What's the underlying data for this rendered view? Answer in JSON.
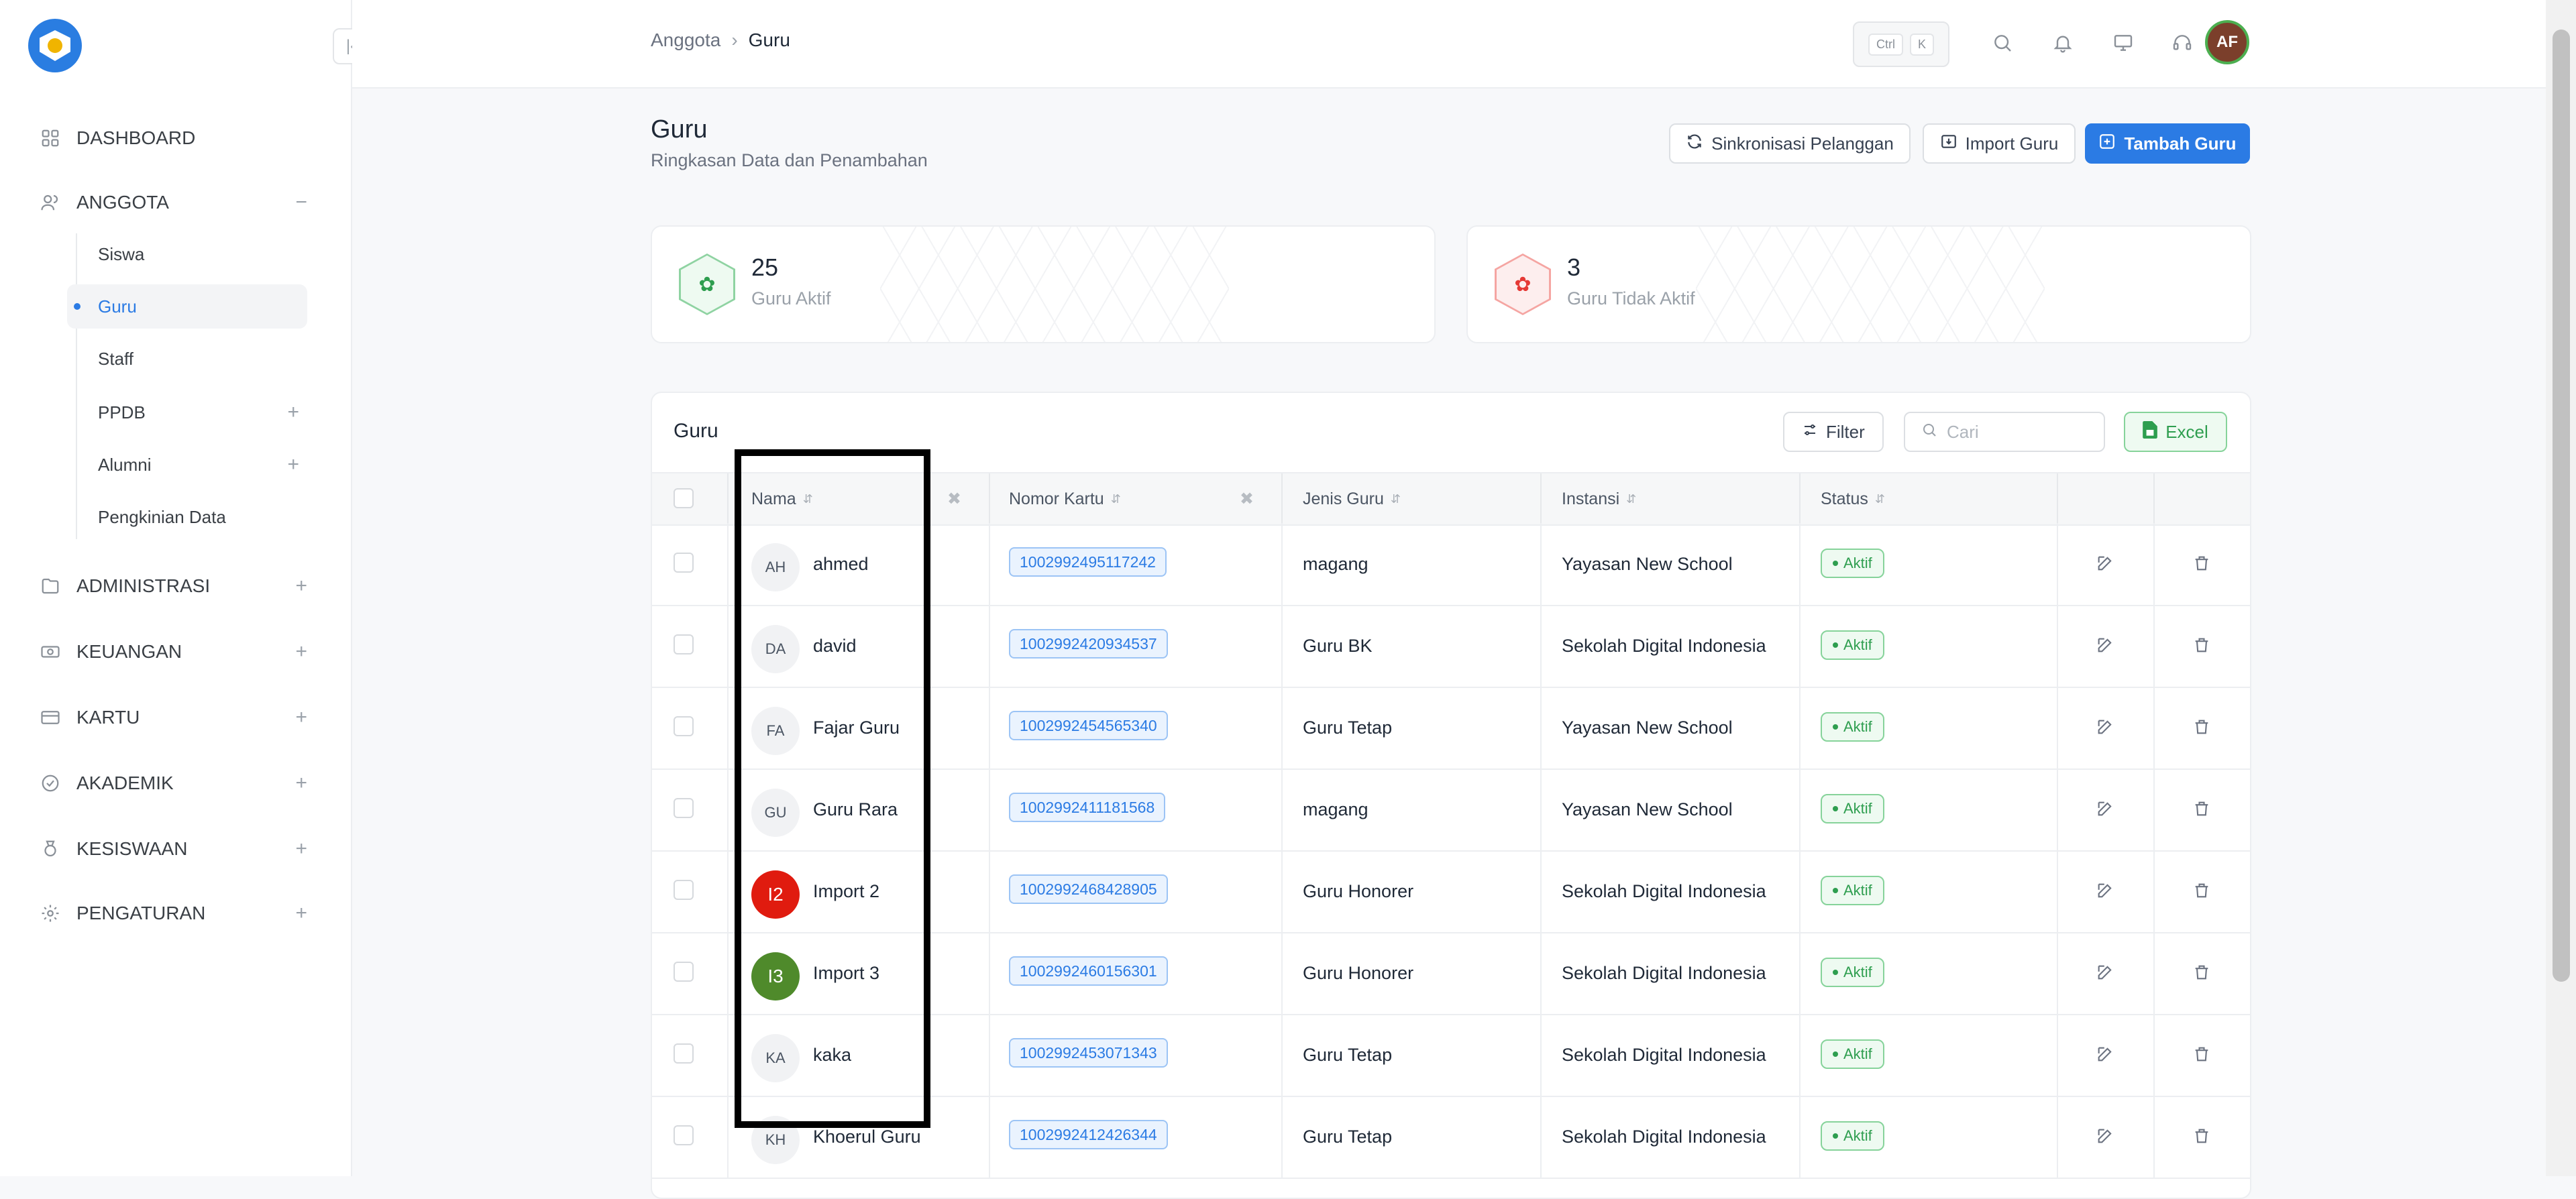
{
  "sidebar": {
    "items": [
      {
        "label": "DASHBOARD",
        "icon": "grid-icon"
      },
      {
        "label": "ANGGOTA",
        "icon": "users-icon",
        "toggle": "−"
      },
      {
        "label": "ADMINISTRASI",
        "icon": "folder-icon",
        "toggle": "+"
      },
      {
        "label": "KEUANGAN",
        "icon": "money-icon",
        "toggle": "+"
      },
      {
        "label": "KARTU",
        "icon": "card-icon",
        "toggle": "+"
      },
      {
        "label": "AKADEMIK",
        "icon": "academic-icon",
        "toggle": "+"
      },
      {
        "label": "KESISWAAN",
        "icon": "medal-icon",
        "toggle": "+"
      },
      {
        "label": "PENGATURAN",
        "icon": "gear-icon",
        "toggle": "+"
      }
    ],
    "subitems": [
      {
        "label": "Siswa"
      },
      {
        "label": "Guru",
        "active": true
      },
      {
        "label": "Staff"
      },
      {
        "label": "PPDB",
        "toggle": "+"
      },
      {
        "label": "Alumni",
        "toggle": "+"
      },
      {
        "label": "Pengkinian Data"
      }
    ]
  },
  "topbar": {
    "breadcrumb": [
      "Anggota",
      "Guru"
    ],
    "kbd": [
      "Ctrl",
      "K"
    ],
    "avatar": "AF"
  },
  "page": {
    "title": "Guru",
    "subtitle": "Ringkasan Data dan Penambahan",
    "buttons": {
      "sync": "Sinkronisasi Pelanggan",
      "import": "Import Guru",
      "add": "Tambah Guru"
    }
  },
  "stats": [
    {
      "value": "25",
      "label": "Guru Aktif",
      "color": "#2e9e4f"
    },
    {
      "value": "3",
      "label": "Guru Tidak Aktif",
      "color": "#e53935"
    }
  ],
  "table": {
    "title": "Guru",
    "filter": "Filter",
    "search_placeholder": "Cari",
    "excel": "Excel",
    "columns": [
      "Nama",
      "Nomor Kartu",
      "Jenis Guru",
      "Instansi",
      "Status"
    ],
    "rows": [
      {
        "initials": "AH",
        "name": "ahmed",
        "card": "1002992495117242",
        "type": "magang",
        "inst": "Yayasan New School",
        "status": "Aktif"
      },
      {
        "initials": "DA",
        "name": "david",
        "card": "1002992420934537",
        "type": "Guru BK",
        "inst": "Sekolah Digital Indonesia",
        "status": "Aktif"
      },
      {
        "initials": "FA",
        "name": "Fajar Guru",
        "card": "1002992454565340",
        "type": "Guru Tetap",
        "inst": "Yayasan New School",
        "status": "Aktif"
      },
      {
        "initials": "GU",
        "name": "Guru Rara",
        "card": "1002992411181568",
        "type": "magang",
        "inst": "Yayasan New School",
        "status": "Aktif"
      },
      {
        "initials": "I2",
        "name": "Import 2",
        "card": "1002992468428905",
        "type": "Guru Honorer",
        "inst": "Sekolah Digital Indonesia",
        "status": "Aktif",
        "avatar_color": "#e01b0f"
      },
      {
        "initials": "I3",
        "name": "Import 3",
        "card": "1002992460156301",
        "type": "Guru Honorer",
        "inst": "Sekolah Digital Indonesia",
        "status": "Aktif",
        "avatar_color": "#4f8a2b"
      },
      {
        "initials": "KA",
        "name": "kaka",
        "card": "1002992453071343",
        "type": "Guru Tetap",
        "inst": "Sekolah Digital Indonesia",
        "status": "Aktif"
      },
      {
        "initials": "KH",
        "name": "Khoerul Guru",
        "card": "1002992412426344",
        "type": "Guru Tetap",
        "inst": "Sekolah Digital Indonesia",
        "status": "Aktif"
      }
    ]
  }
}
